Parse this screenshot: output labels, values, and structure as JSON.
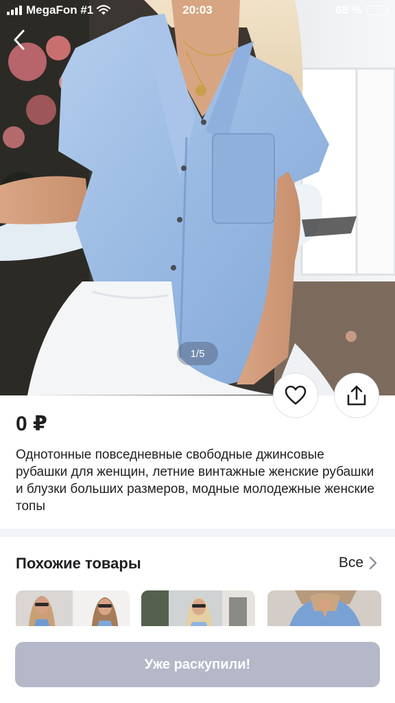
{
  "status_bar": {
    "carrier": "MegaFon #1",
    "time": "20:03",
    "battery_percent": "68 %",
    "battery_level": 0.68
  },
  "gallery": {
    "counter": "1/5"
  },
  "product": {
    "price": "0 ₽",
    "title": "Однотонные повседневные свободные джинсовые рубашки для женщин, летние винтажные женские рубашки и блузки больших размеров, модные молодежные женские топы"
  },
  "similar": {
    "heading": "Похожие товары",
    "all_label": "Все"
  },
  "cta": {
    "label": "Уже раскупили!"
  },
  "colors": {
    "cta_disabled": "#b4b8c8",
    "denim": "#9dbfe6",
    "text": "#1f1f22"
  },
  "icons": [
    "back-chevron-icon",
    "heart-icon",
    "share-icon",
    "chevron-right-icon",
    "wifi-icon",
    "signal-icon",
    "battery-icon"
  ]
}
